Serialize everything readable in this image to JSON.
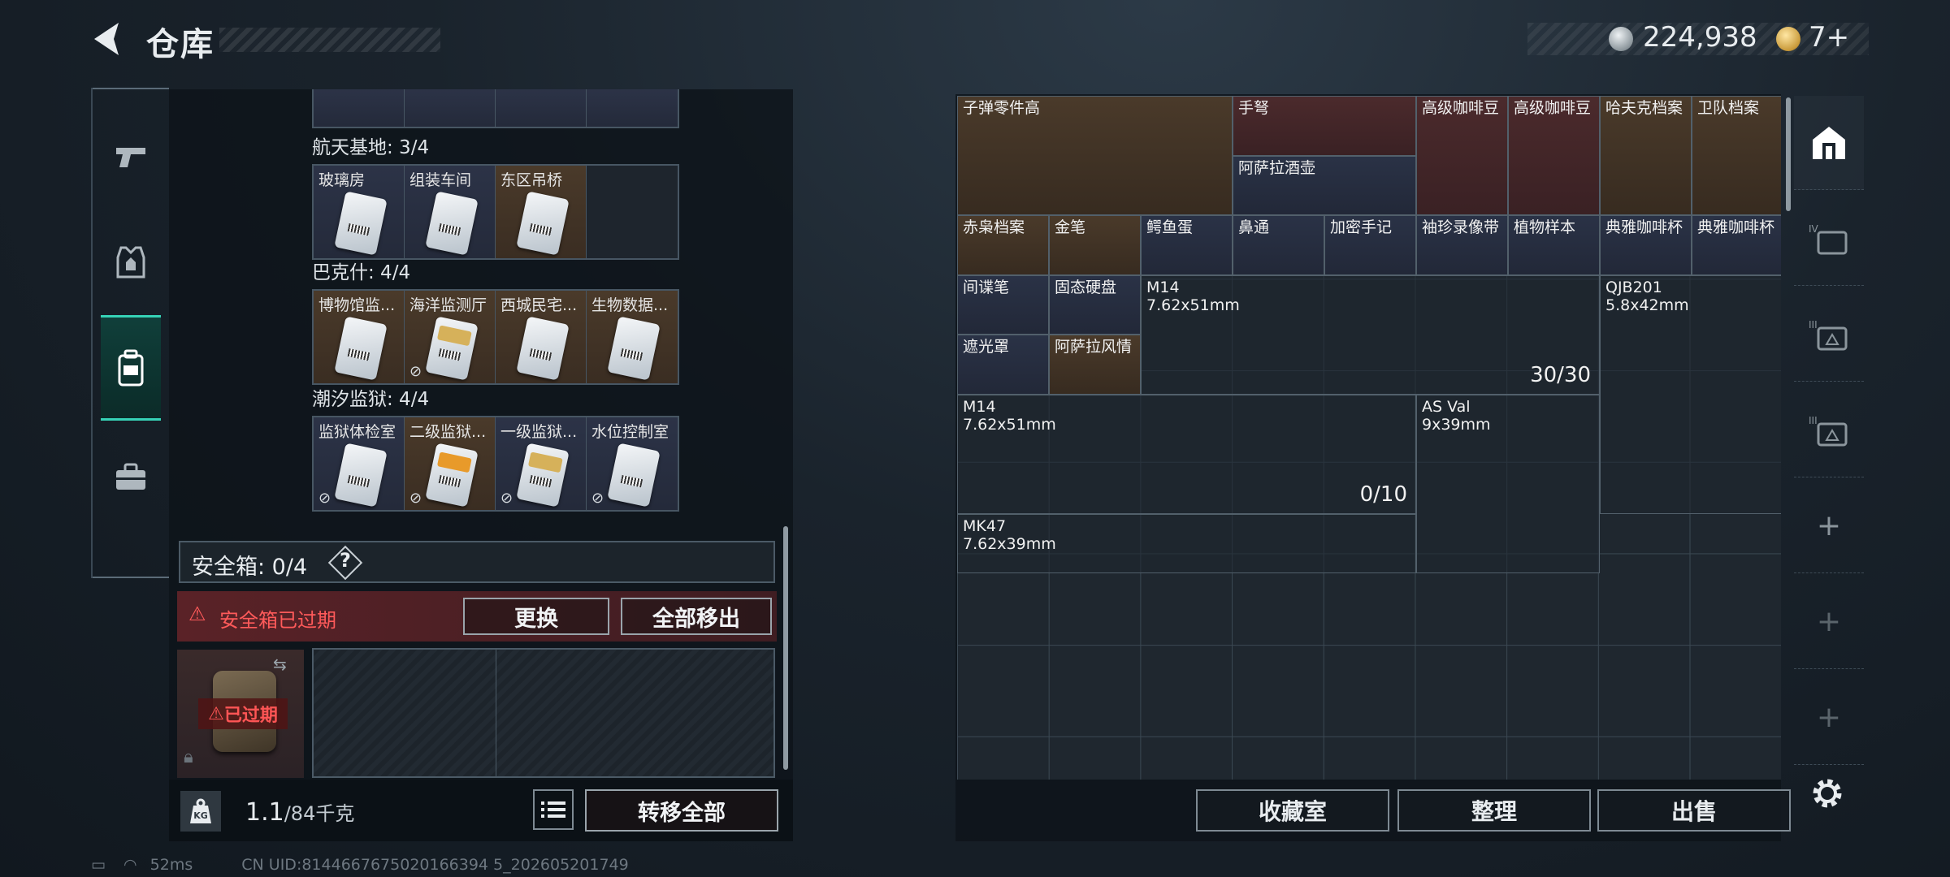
{
  "header": {
    "title": "仓库"
  },
  "currency": {
    "coins": "224,938",
    "gold": "7+"
  },
  "left_panel": {
    "sections": [
      {
        "title": "航天基地: 3/4",
        "slots": [
          {
            "label": "玻璃房",
            "style": "blue",
            "card": "plain",
            "unlinked": false
          },
          {
            "label": "组装车间",
            "style": "blue",
            "card": "plain",
            "unlinked": false
          },
          {
            "label": "东区吊桥",
            "style": "gold",
            "card": "plain",
            "unlinked": false
          },
          {
            "label": "",
            "style": "empty",
            "card": "",
            "unlinked": false
          }
        ]
      },
      {
        "title": "巴克什: 4/4",
        "slots": [
          {
            "label": "博物馆监...",
            "style": "gold",
            "card": "plain",
            "unlinked": false
          },
          {
            "label": "海洋监测厅",
            "style": "gold",
            "card": "gold2",
            "unlinked": true
          },
          {
            "label": "西城民宅...",
            "style": "gold",
            "card": "plain",
            "unlinked": false
          },
          {
            "label": "生物数据...",
            "style": "gold",
            "card": "plain",
            "unlinked": false
          }
        ]
      },
      {
        "title": "潮汐监狱: 4/4",
        "slots": [
          {
            "label": "监狱体检室",
            "style": "blue",
            "card": "plain",
            "unlinked": true
          },
          {
            "label": "二级监狱...",
            "style": "gold",
            "card": "orange",
            "unlinked": true
          },
          {
            "label": "一级监狱...",
            "style": "blue",
            "card": "gold2",
            "unlinked": true
          },
          {
            "label": "水位控制室",
            "style": "blue",
            "card": "plain",
            "unlinked": true
          }
        ]
      }
    ]
  },
  "safe_box": {
    "title": "安全箱: 0/4",
    "help": "?",
    "expired_warning": "安全箱已过期",
    "replace_label": "更换",
    "remove_all_label": "全部移出",
    "expired_tag": "已过期"
  },
  "weight": {
    "value": "1.1",
    "unit": "/84千克"
  },
  "transfer_all_label": "转移全部",
  "storage": {
    "items": [
      {
        "name": "子弹零件高",
        "count": "",
        "style": "gold"
      },
      {
        "name": "手弩",
        "count": "",
        "style": "red"
      },
      {
        "name": "阿萨拉酒壶",
        "count": "",
        "style": "blue"
      },
      {
        "name": "高级咖啡豆",
        "count": "",
        "style": "red"
      },
      {
        "name": "高级咖啡豆",
        "count": "",
        "style": "red"
      },
      {
        "name": "哈夫克档案",
        "count": "",
        "style": "gold"
      },
      {
        "name": "卫队档案",
        "count": "",
        "style": "gold"
      },
      {
        "name": "赤枭档案",
        "count": "",
        "style": "gold"
      },
      {
        "name": "金笔",
        "count": "",
        "style": "gold"
      },
      {
        "name": "鳄鱼蛋",
        "count": "",
        "style": "blue"
      },
      {
        "name": "鼻通",
        "count": "",
        "style": "blue"
      },
      {
        "name": "加密手记",
        "count": "",
        "style": "blue"
      },
      {
        "name": "袖珍录像带",
        "count": "",
        "style": "blue"
      },
      {
        "name": "植物样本",
        "count": "",
        "style": "blue"
      },
      {
        "name": "典雅咖啡杯",
        "count": "",
        "style": "blue"
      },
      {
        "name": "典雅咖啡杯",
        "count": "",
        "style": "blue"
      },
      {
        "name": "间谍笔",
        "count": "",
        "style": "blue"
      },
      {
        "name": "固态硬盘",
        "count": "",
        "style": "blue"
      },
      {
        "name": "M14\n7.62x51mm",
        "count": "30/30",
        "style": "dark"
      },
      {
        "name": "QJB201\n5.8x42mm",
        "count": "",
        "style": "dark"
      },
      {
        "name": "遮光罩",
        "count": "",
        "style": "blue"
      },
      {
        "name": "阿萨拉风情",
        "count": "",
        "style": "gold"
      },
      {
        "name": "M14\n7.62x51mm",
        "count": "0/10",
        "style": "dark"
      },
      {
        "name": "AS Val\n9x39mm",
        "count": "",
        "style": "dark"
      },
      {
        "name": "MK47\n7.62x39mm",
        "count": "",
        "style": "dark"
      }
    ],
    "buttons": {
      "collection": "收藏室",
      "sort": "整理",
      "sell": "出售"
    }
  },
  "right_rail": [
    "home-icon",
    "case-iv-icon",
    "case-iii-icon",
    "case-iii-b-icon",
    "add-icon",
    "add-icon",
    "add-icon"
  ],
  "status_bar": {
    "ping": "52ms",
    "uid": "CN UID:8144667675020166394 5_202605201749"
  }
}
